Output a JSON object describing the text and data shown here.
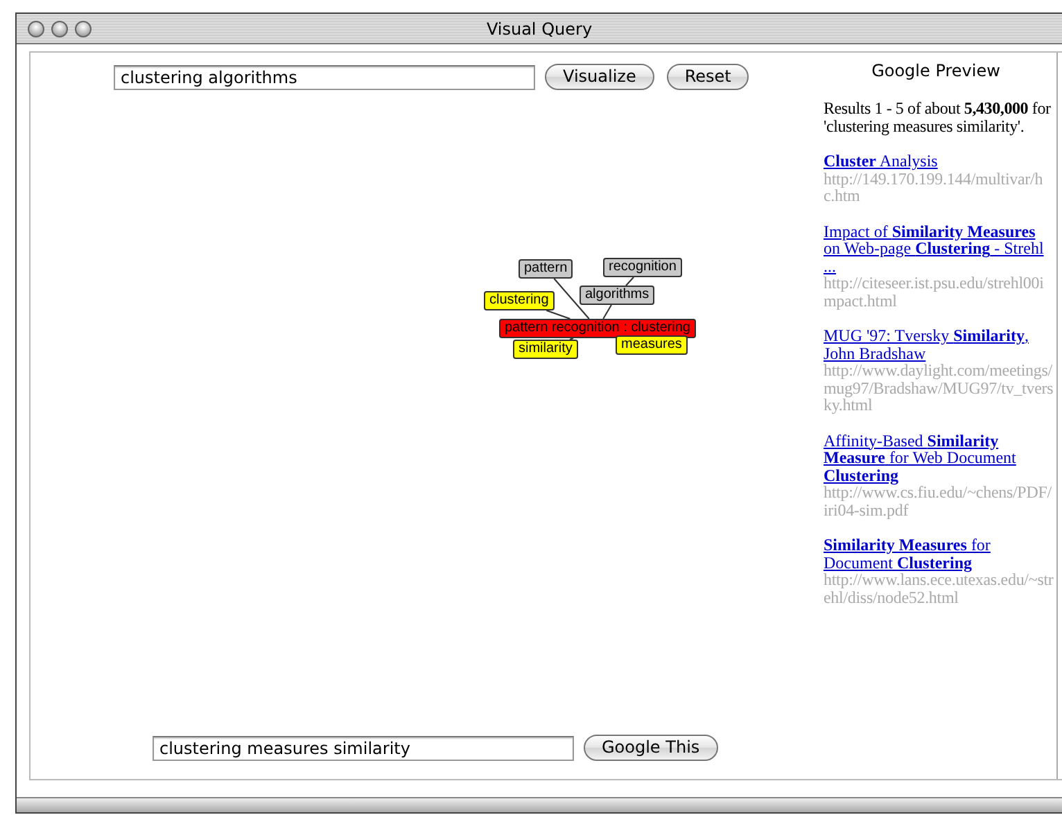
{
  "window": {
    "title": "Visual Query"
  },
  "query": {
    "value": "clustering algorithms",
    "buttons": [
      "Visualize",
      "Reset"
    ]
  },
  "graph": {
    "nodes": [
      {
        "label": "pattern",
        "color": "#c8c8c8"
      },
      {
        "label": "recognition",
        "color": "#c8c8c8"
      },
      {
        "label": "clustering",
        "color": "#ffff00"
      },
      {
        "label": "algorithms",
        "color": "#c8c8c8"
      },
      {
        "label": "pattern recognition : clustering",
        "color": "#ff0000"
      },
      {
        "label": "similarity",
        "color": "#ffff00"
      },
      {
        "label": "measures",
        "color": "#ffff00"
      }
    ]
  },
  "search": {
    "value": "clustering measures similarity",
    "button": "Google This"
  },
  "preview": {
    "title": "Google Preview",
    "summary": "Results 1 - 5 of about **5,430,000** for 'clustering measures similarity'.",
    "results": [
      {
        "title": "**Cluster** Analysis",
        "url": "http://149.170.199.144/multivar/hc.htm"
      },
      {
        "title": "Impact of **Similarity Measures** on Web-page **Clustering** - Strehl ...",
        "url": "http://citeseer.ist.psu.edu/strehl00impact.html"
      },
      {
        "title": "MUG '97: Tversky **Similarity**, John Bradshaw",
        "url": "http://www.daylight.com/meetings/mug97/Bradshaw/MUG97/tv_tversky.html"
      },
      {
        "title": "Affinity-Based **Similarity Measure** for Web Document **Clustering**",
        "url": "http://www.cs.fiu.edu/~chens/PDF/iri04-sim.pdf"
      },
      {
        "title": "**Similarity Measures** for Document **Clustering**",
        "url": "http://www.lans.ece.utexas.edu/~strehl/diss/node52.html"
      }
    ]
  }
}
